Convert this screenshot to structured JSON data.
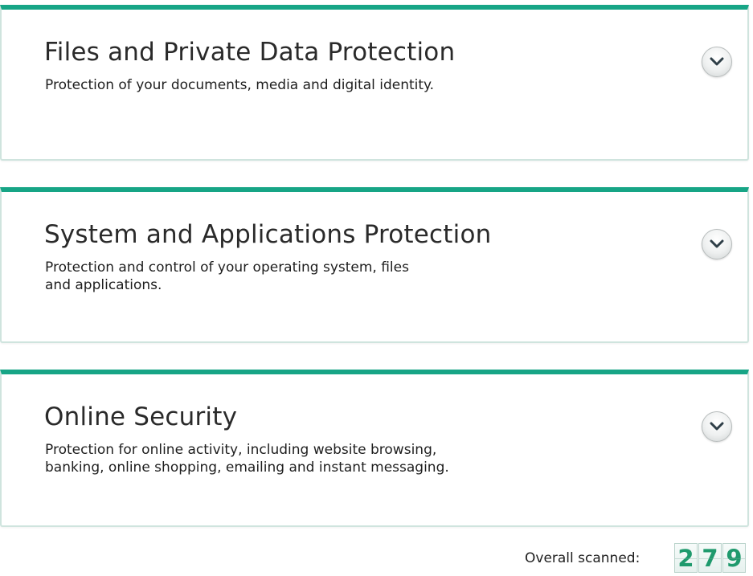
{
  "sections": [
    {
      "title": "Files and Private Data Protection",
      "description": "Protection of your documents, media and digital identity.",
      "expand_icon": "chevron-down-icon"
    },
    {
      "title": "System and Applications Protection",
      "description": "Protection and control of your operating system, files\nand applications.",
      "expand_icon": "chevron-down-icon"
    },
    {
      "title": "Online Security",
      "description": "Protection for online activity, including website browsing,\nbanking, online shopping, emailing and instant messaging.",
      "expand_icon": "chevron-down-icon"
    }
  ],
  "footer": {
    "label": "Overall scanned:",
    "counter_digits": [
      "2",
      "7",
      "9"
    ]
  },
  "colors": {
    "accent": "#17a586",
    "counter_digit": "#1f9a6d"
  }
}
